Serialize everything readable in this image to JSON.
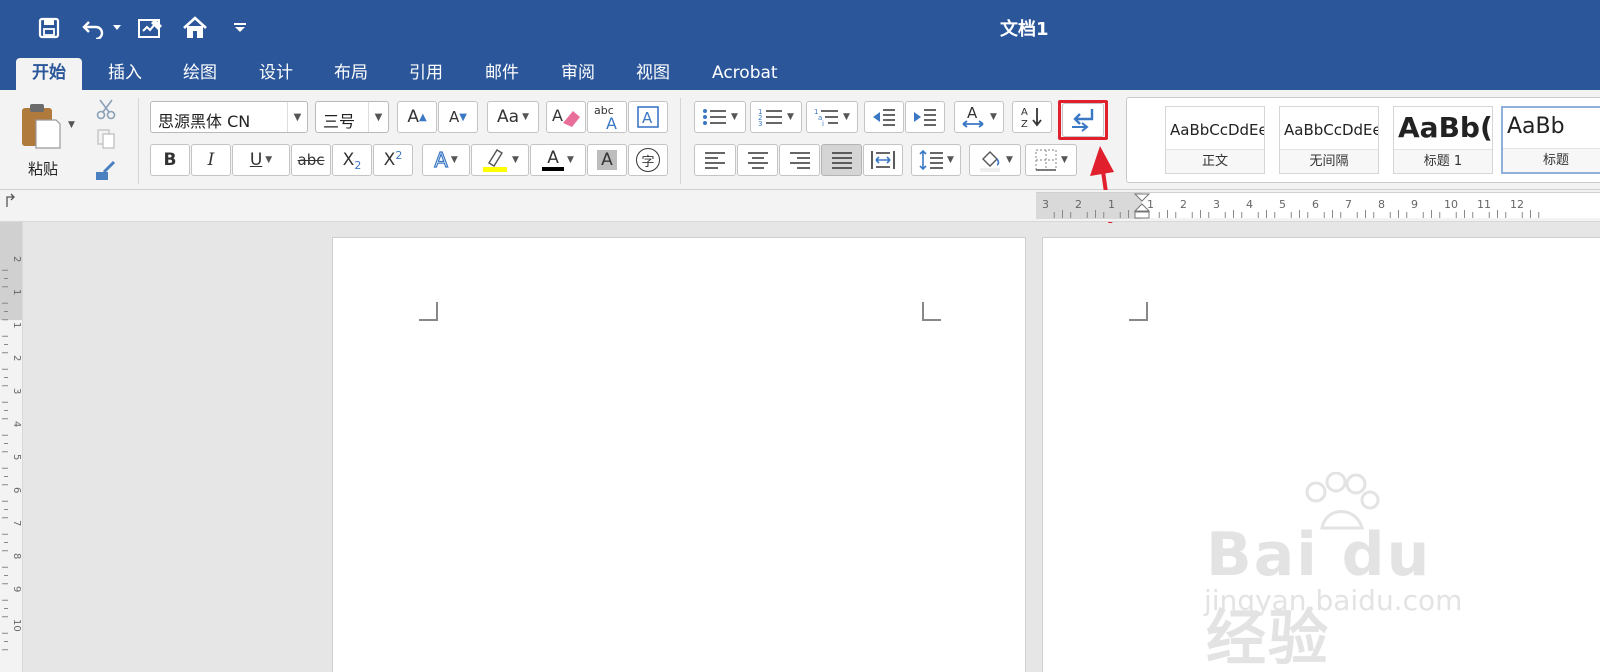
{
  "window": {
    "title": "文档1"
  },
  "quick_access": {
    "icons": [
      "save-icon",
      "undo-icon",
      "dropdown-icon",
      "edit-doc-icon",
      "home-icon",
      "customize-icon"
    ]
  },
  "tabs": [
    {
      "label": "开始",
      "active": true
    },
    {
      "label": "插入"
    },
    {
      "label": "绘图"
    },
    {
      "label": "设计"
    },
    {
      "label": "布局"
    },
    {
      "label": "引用"
    },
    {
      "label": "邮件"
    },
    {
      "label": "审阅"
    },
    {
      "label": "视图"
    },
    {
      "label": "Acrobat"
    }
  ],
  "clipboard": {
    "paste_label": "粘贴"
  },
  "font": {
    "family": "思源黑体 CN",
    "size": "三号",
    "bold": "B",
    "italic": "I",
    "underline": "U",
    "strike": "abc",
    "subscript": "X",
    "subscript_mark": "2",
    "superscript": "X",
    "superscript_mark": "2",
    "grow": "A",
    "shrink": "A",
    "change_case": "Aa",
    "spelling": "abc",
    "text_effect": "A",
    "font_color": "A",
    "char_shading": "A",
    "enclose": "字"
  },
  "colors": {
    "brand": "#2b579a",
    "highlight": "#ffff00",
    "font_color_bar": "#000000",
    "annotation": "#e0202c"
  },
  "styles": [
    {
      "sample": "AaBbCcDdEe",
      "name": "正文"
    },
    {
      "sample": "AaBbCcDdEe",
      "name": "无间隔"
    },
    {
      "sample": "AaBb(",
      "name": "标题 1"
    },
    {
      "sample": "AaBb",
      "name": "标题"
    }
  ],
  "ruler": {
    "h_labels": [
      "3",
      "2",
      "1",
      "1",
      "2",
      "3",
      "4",
      "5",
      "6",
      "7",
      "8",
      "9",
      "10",
      "11",
      "12"
    ],
    "v_labels": [
      "2",
      "1",
      "1",
      "2",
      "3",
      "4",
      "5",
      "6",
      "7",
      "8",
      "9",
      "10"
    ]
  },
  "watermark": {
    "brand": "Bai du 经验",
    "url": "jingyan.baidu.com"
  }
}
